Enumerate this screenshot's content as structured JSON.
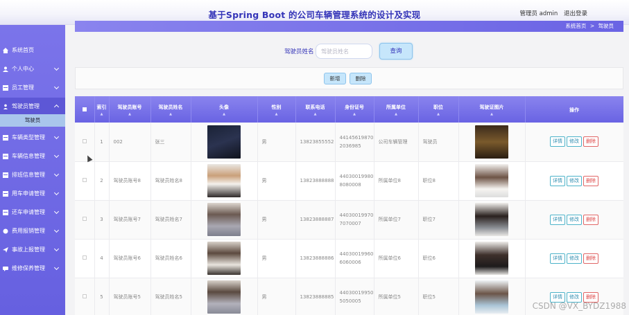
{
  "header": {
    "title": "基于Spring Boot 的公司车辆管理系统的设计及实现",
    "user_label": "管理员 admin",
    "logout_label": "退出登录"
  },
  "sidebar": {
    "items": [
      {
        "label": "系统首页",
        "icon": "home-icon",
        "has_arrow": false
      },
      {
        "label": "个人中心",
        "icon": "user-icon",
        "has_arrow": true
      },
      {
        "label": "员工管理",
        "icon": "grid-icon",
        "has_arrow": true
      },
      {
        "label": "驾驶员管理",
        "icon": "person-icon",
        "has_arrow": true,
        "open": true
      },
      {
        "label": "车辆类型管理",
        "icon": "grid-icon",
        "has_arrow": true
      },
      {
        "label": "车辆信息管理",
        "icon": "grid-icon",
        "has_arrow": true
      },
      {
        "label": "排班信息管理",
        "icon": "grid-icon",
        "has_arrow": true
      },
      {
        "label": "用车申请管理",
        "icon": "grid-icon",
        "has_arrow": true
      },
      {
        "label": "还车申请管理",
        "icon": "grid-icon",
        "has_arrow": true
      },
      {
        "label": "费用报销管理",
        "icon": "globe-icon",
        "has_arrow": true
      },
      {
        "label": "事故上报管理",
        "icon": "send-icon",
        "has_arrow": true
      },
      {
        "label": "维修保养管理",
        "icon": "chat-icon",
        "has_arrow": true
      }
    ],
    "active_sub": "驾驶员"
  },
  "breadcrumb": {
    "home": "系统首页",
    "separator": ">",
    "current": "驾驶员"
  },
  "search": {
    "label": "驾驶员姓名",
    "placeholder": "驾驶员姓名",
    "value": "",
    "button": "查询"
  },
  "actions": {
    "add": "新增",
    "delete": "删除"
  },
  "table": {
    "columns": [
      "索引",
      "驾驶员账号",
      "驾驶员姓名",
      "头像",
      "性别",
      "联系电话",
      "身份证号",
      "所属单位",
      "职位",
      "驾驶证图片",
      "操作"
    ],
    "rows": [
      {
        "index": "1",
        "account": "002",
        "name": "张三",
        "gender": "男",
        "phone": "13823855552",
        "id_card": "441456198702036985",
        "unit": "公司车辆管理",
        "position": "驾驶员"
      },
      {
        "index": "2",
        "account": "驾驶员账号8",
        "name": "驾驶员姓名8",
        "gender": "男",
        "phone": "13823888888",
        "id_card": "440300199808080008",
        "unit": "所属单位8",
        "position": "职位8"
      },
      {
        "index": "3",
        "account": "驾驶员账号7",
        "name": "驾驶员姓名7",
        "gender": "男",
        "phone": "13823888887",
        "id_card": "440300199707070007",
        "unit": "所属单位7",
        "position": "职位7"
      },
      {
        "index": "4",
        "account": "驾驶员账号6",
        "name": "驾驶员姓名6",
        "gender": "男",
        "phone": "13823888886",
        "id_card": "440300199606060006",
        "unit": "所属单位6",
        "position": "职位6"
      },
      {
        "index": "5",
        "account": "驾驶员账号5",
        "name": "驾驶员姓名5",
        "gender": "男",
        "phone": "13823888885",
        "id_card": "440300199505050005",
        "unit": "所属单位5",
        "position": "职位5"
      }
    ],
    "row_actions": {
      "detail": "详情",
      "edit": "修改",
      "delete": "删除"
    }
  },
  "watermark": "CSDN @VX_BYDZ1988",
  "colors": {
    "accent": "#6a63e4",
    "title": "#3434b8",
    "sub_active": "#a9c6ec"
  }
}
